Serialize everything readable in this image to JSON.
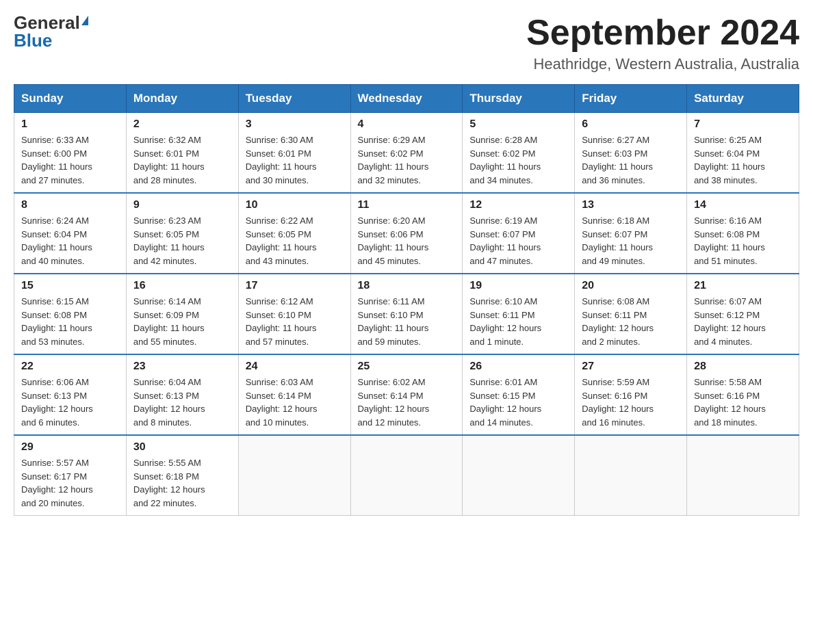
{
  "logo": {
    "general": "General",
    "blue": "Blue"
  },
  "title": "September 2024",
  "subtitle": "Heathridge, Western Australia, Australia",
  "columns": [
    "Sunday",
    "Monday",
    "Tuesday",
    "Wednesday",
    "Thursday",
    "Friday",
    "Saturday"
  ],
  "weeks": [
    [
      {
        "day": "1",
        "info": "Sunrise: 6:33 AM\nSunset: 6:00 PM\nDaylight: 11 hours\nand 27 minutes."
      },
      {
        "day": "2",
        "info": "Sunrise: 6:32 AM\nSunset: 6:01 PM\nDaylight: 11 hours\nand 28 minutes."
      },
      {
        "day": "3",
        "info": "Sunrise: 6:30 AM\nSunset: 6:01 PM\nDaylight: 11 hours\nand 30 minutes."
      },
      {
        "day": "4",
        "info": "Sunrise: 6:29 AM\nSunset: 6:02 PM\nDaylight: 11 hours\nand 32 minutes."
      },
      {
        "day": "5",
        "info": "Sunrise: 6:28 AM\nSunset: 6:02 PM\nDaylight: 11 hours\nand 34 minutes."
      },
      {
        "day": "6",
        "info": "Sunrise: 6:27 AM\nSunset: 6:03 PM\nDaylight: 11 hours\nand 36 minutes."
      },
      {
        "day": "7",
        "info": "Sunrise: 6:25 AM\nSunset: 6:04 PM\nDaylight: 11 hours\nand 38 minutes."
      }
    ],
    [
      {
        "day": "8",
        "info": "Sunrise: 6:24 AM\nSunset: 6:04 PM\nDaylight: 11 hours\nand 40 minutes."
      },
      {
        "day": "9",
        "info": "Sunrise: 6:23 AM\nSunset: 6:05 PM\nDaylight: 11 hours\nand 42 minutes."
      },
      {
        "day": "10",
        "info": "Sunrise: 6:22 AM\nSunset: 6:05 PM\nDaylight: 11 hours\nand 43 minutes."
      },
      {
        "day": "11",
        "info": "Sunrise: 6:20 AM\nSunset: 6:06 PM\nDaylight: 11 hours\nand 45 minutes."
      },
      {
        "day": "12",
        "info": "Sunrise: 6:19 AM\nSunset: 6:07 PM\nDaylight: 11 hours\nand 47 minutes."
      },
      {
        "day": "13",
        "info": "Sunrise: 6:18 AM\nSunset: 6:07 PM\nDaylight: 11 hours\nand 49 minutes."
      },
      {
        "day": "14",
        "info": "Sunrise: 6:16 AM\nSunset: 6:08 PM\nDaylight: 11 hours\nand 51 minutes."
      }
    ],
    [
      {
        "day": "15",
        "info": "Sunrise: 6:15 AM\nSunset: 6:08 PM\nDaylight: 11 hours\nand 53 minutes."
      },
      {
        "day": "16",
        "info": "Sunrise: 6:14 AM\nSunset: 6:09 PM\nDaylight: 11 hours\nand 55 minutes."
      },
      {
        "day": "17",
        "info": "Sunrise: 6:12 AM\nSunset: 6:10 PM\nDaylight: 11 hours\nand 57 minutes."
      },
      {
        "day": "18",
        "info": "Sunrise: 6:11 AM\nSunset: 6:10 PM\nDaylight: 11 hours\nand 59 minutes."
      },
      {
        "day": "19",
        "info": "Sunrise: 6:10 AM\nSunset: 6:11 PM\nDaylight: 12 hours\nand 1 minute."
      },
      {
        "day": "20",
        "info": "Sunrise: 6:08 AM\nSunset: 6:11 PM\nDaylight: 12 hours\nand 2 minutes."
      },
      {
        "day": "21",
        "info": "Sunrise: 6:07 AM\nSunset: 6:12 PM\nDaylight: 12 hours\nand 4 minutes."
      }
    ],
    [
      {
        "day": "22",
        "info": "Sunrise: 6:06 AM\nSunset: 6:13 PM\nDaylight: 12 hours\nand 6 minutes."
      },
      {
        "day": "23",
        "info": "Sunrise: 6:04 AM\nSunset: 6:13 PM\nDaylight: 12 hours\nand 8 minutes."
      },
      {
        "day": "24",
        "info": "Sunrise: 6:03 AM\nSunset: 6:14 PM\nDaylight: 12 hours\nand 10 minutes."
      },
      {
        "day": "25",
        "info": "Sunrise: 6:02 AM\nSunset: 6:14 PM\nDaylight: 12 hours\nand 12 minutes."
      },
      {
        "day": "26",
        "info": "Sunrise: 6:01 AM\nSunset: 6:15 PM\nDaylight: 12 hours\nand 14 minutes."
      },
      {
        "day": "27",
        "info": "Sunrise: 5:59 AM\nSunset: 6:16 PM\nDaylight: 12 hours\nand 16 minutes."
      },
      {
        "day": "28",
        "info": "Sunrise: 5:58 AM\nSunset: 6:16 PM\nDaylight: 12 hours\nand 18 minutes."
      }
    ],
    [
      {
        "day": "29",
        "info": "Sunrise: 5:57 AM\nSunset: 6:17 PM\nDaylight: 12 hours\nand 20 minutes."
      },
      {
        "day": "30",
        "info": "Sunrise: 5:55 AM\nSunset: 6:18 PM\nDaylight: 12 hours\nand 22 minutes."
      },
      {
        "day": "",
        "info": ""
      },
      {
        "day": "",
        "info": ""
      },
      {
        "day": "",
        "info": ""
      },
      {
        "day": "",
        "info": ""
      },
      {
        "day": "",
        "info": ""
      }
    ]
  ]
}
